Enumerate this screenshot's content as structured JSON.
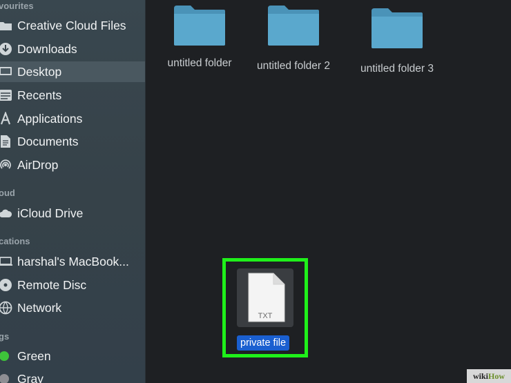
{
  "sidebar": {
    "favourites_header": "vourites",
    "icloud_header": "oud",
    "locations_header": "cations",
    "tags_header": "gs",
    "items": [
      {
        "label": "Creative Cloud Files",
        "icon": "creative-cloud-folder-icon"
      },
      {
        "label": "Downloads",
        "icon": "downloads-icon"
      },
      {
        "label": "Desktop",
        "icon": "desktop-icon"
      },
      {
        "label": "Recents",
        "icon": "recents-icon"
      },
      {
        "label": "Applications",
        "icon": "applications-icon"
      },
      {
        "label": "Documents",
        "icon": "documents-icon"
      },
      {
        "label": "AirDrop",
        "icon": "airdrop-icon"
      },
      {
        "label": "iCloud Drive",
        "icon": "cloud-icon"
      },
      {
        "label": "harshal's MacBook...",
        "icon": "laptop-icon"
      },
      {
        "label": "Remote Disc",
        "icon": "disc-icon"
      },
      {
        "label": "Network",
        "icon": "network-icon"
      }
    ],
    "tags": [
      {
        "label": "Green",
        "color": "#3ec43a"
      },
      {
        "label": "Gray",
        "color": "#8e8e93"
      }
    ],
    "selected": "Desktop"
  },
  "main": {
    "folders": [
      {
        "label": "untitled folder"
      },
      {
        "label": "untitled folder 2"
      },
      {
        "label": "untitled folder 3"
      }
    ],
    "file": {
      "name": "private file",
      "type": "TXT"
    }
  },
  "colors": {
    "highlight": "#1ff01a",
    "selection": "#1a5fd0",
    "folder": "#5aa8cd"
  },
  "watermark": {
    "wiki": "wiki",
    "how": "How"
  }
}
